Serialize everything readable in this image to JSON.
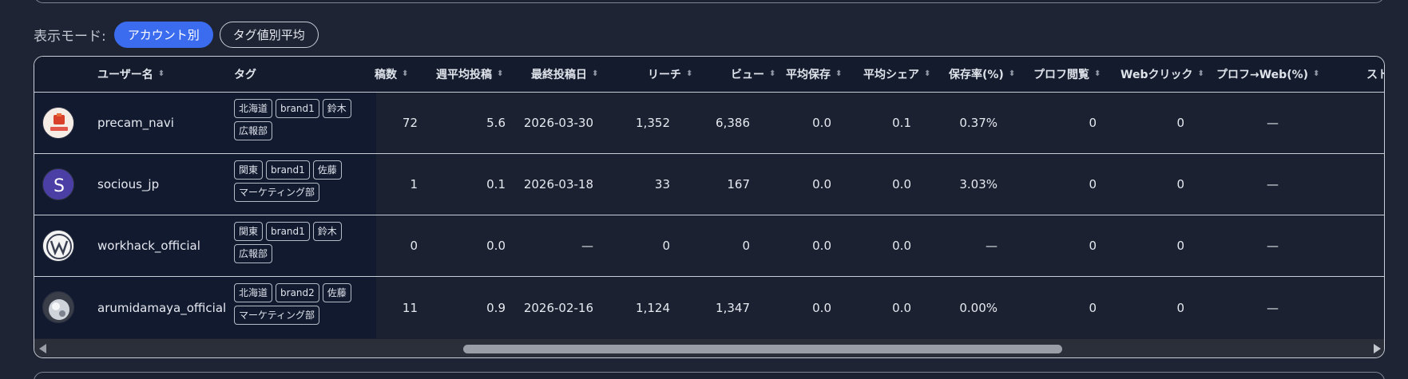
{
  "mode": {
    "label": "表示モード:",
    "options": [
      "アカウント別",
      "タグ値別平均"
    ],
    "active_index": 0
  },
  "colors": {
    "accent": "#3b6cf0",
    "background": "#1e2433"
  },
  "table": {
    "headers": {
      "username": "ユーザー名",
      "tags": "タグ",
      "posts": "稿数",
      "weekly_avg": "週平均投稿",
      "last_post": "最終投稿日",
      "reach": "リーチ",
      "views": "ビュー",
      "avg_saves": "平均保存",
      "avg_shares": "平均シェア",
      "save_rate": "保存率(%)",
      "profile_views": "プロフ閲覧",
      "web_clicks": "Webクリック",
      "profile_web": "プロフ→Web(%)",
      "cut": "スト"
    },
    "rows": [
      {
        "avatar": "precam-logo-icon",
        "username": "precam_navi",
        "tags": [
          "北海道",
          "brand1",
          "鈴木",
          "広報部"
        ],
        "posts": "72",
        "weekly_avg": "5.6",
        "last_post": "2026-03-30",
        "reach": "1,352",
        "views": "6,386",
        "avg_saves": "0.0",
        "avg_shares": "0.1",
        "save_rate": "0.37%",
        "profile_views": "0",
        "web_clicks": "0",
        "profile_web": "—"
      },
      {
        "avatar": "socious-s-icon",
        "username": "socious_jp",
        "tags": [
          "関東",
          "brand1",
          "佐藤",
          "マーケティング部"
        ],
        "posts": "1",
        "weekly_avg": "0.1",
        "last_post": "2026-03-18",
        "reach": "33",
        "views": "167",
        "avg_saves": "0.0",
        "avg_shares": "0.0",
        "save_rate": "3.03%",
        "profile_views": "0",
        "web_clicks": "0",
        "profile_web": "—"
      },
      {
        "avatar": "workhack-w-icon",
        "username": "workhack_official",
        "tags": [
          "関東",
          "brand1",
          "鈴木",
          "広報部"
        ],
        "posts": "0",
        "weekly_avg": "0.0",
        "last_post": "—",
        "reach": "0",
        "views": "0",
        "avg_saves": "0.0",
        "avg_shares": "0.0",
        "save_rate": "—",
        "profile_views": "0",
        "web_clicks": "0",
        "profile_web": "—"
      },
      {
        "avatar": "arumidamaya-sphere-icon",
        "username": "arumidamaya_official",
        "tags": [
          "北海道",
          "brand2",
          "佐藤",
          "マーケティング部"
        ],
        "posts": "11",
        "weekly_avg": "0.9",
        "last_post": "2026-02-16",
        "reach": "1,124",
        "views": "1,347",
        "avg_saves": "0.0",
        "avg_shares": "0.0",
        "save_rate": "0.00%",
        "profile_views": "0",
        "web_clicks": "0",
        "profile_web": "—"
      }
    ]
  }
}
